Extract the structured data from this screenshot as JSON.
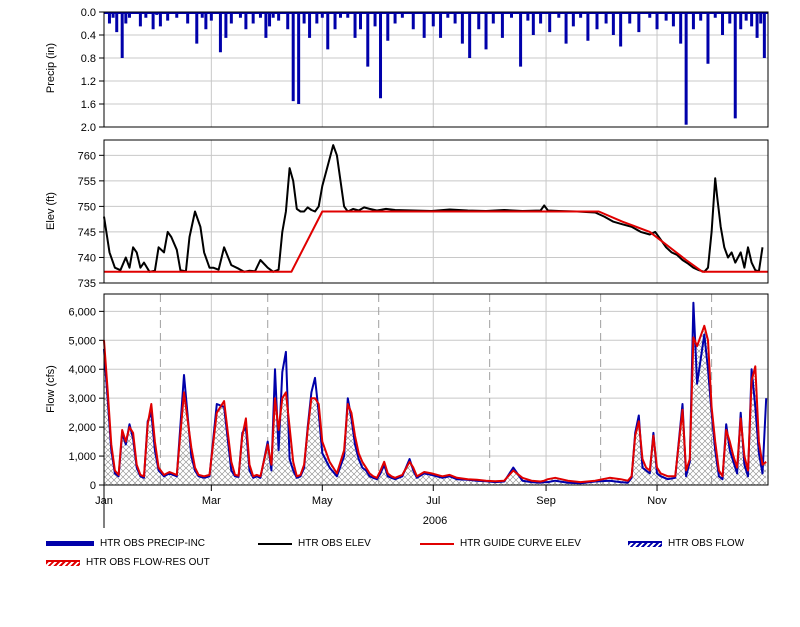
{
  "chart_data": [
    {
      "type": "bar",
      "ylabel": "Precip (in)",
      "ylim": [
        2.0,
        0.0
      ],
      "inverted": true,
      "yticks": [
        "0.0",
        "0.4",
        "0.8",
        "1.2",
        "1.6",
        "2.0"
      ],
      "grid": true,
      "color": "#0000aa",
      "series": [
        {
          "name": "HTR OBS PRECIP-INC",
          "x_day": [
            3,
            5,
            7,
            10,
            12,
            14,
            20,
            23,
            27,
            29,
            31,
            35,
            40,
            46,
            51,
            54,
            56,
            59,
            64,
            67,
            70,
            75,
            78,
            82,
            86,
            89,
            91,
            93,
            96,
            101,
            104,
            107,
            110,
            113,
            117,
            120,
            123,
            127,
            130,
            134,
            138,
            141,
            145,
            149,
            152,
            156,
            160,
            164,
            170,
            176,
            181,
            185,
            189,
            193,
            197,
            201,
            206,
            210,
            214,
            219,
            224,
            229,
            233,
            236,
            240,
            245,
            250,
            254,
            258,
            262,
            266,
            271,
            276,
            280,
            284,
            289,
            294,
            300,
            304,
            309,
            313,
            317,
            320,
            324,
            328,
            332,
            336,
            340,
            344,
            347,
            350,
            353,
            356,
            359,
            361,
            363
          ],
          "values": [
            0.2,
            0.1,
            0.35,
            0.8,
            0.2,
            0.1,
            0.25,
            0.1,
            0.3,
            0.05,
            0.25,
            0.15,
            0.1,
            0.2,
            0.55,
            0.1,
            0.3,
            0.15,
            0.7,
            0.45,
            0.2,
            0.1,
            0.3,
            0.2,
            0.1,
            0.45,
            0.25,
            0.1,
            0.15,
            0.3,
            1.55,
            1.6,
            0.2,
            0.45,
            0.2,
            0.1,
            0.65,
            0.3,
            0.1,
            0.1,
            0.45,
            0.3,
            0.95,
            0.25,
            1.5,
            0.5,
            0.2,
            0.1,
            0.3,
            0.45,
            0.25,
            0.45,
            0.1,
            0.2,
            0.55,
            0.8,
            0.3,
            0.65,
            0.2,
            0.45,
            0.1,
            0.95,
            0.15,
            0.4,
            0.2,
            0.35,
            0.1,
            0.55,
            0.25,
            0.1,
            0.5,
            0.3,
            0.2,
            0.4,
            0.6,
            0.2,
            0.35,
            0.1,
            0.3,
            0.15,
            0.25,
            0.55,
            1.96,
            0.3,
            0.15,
            0.9,
            0.1,
            0.4,
            0.2,
            1.85,
            0.3,
            0.15,
            0.25,
            0.45,
            0.2,
            0.8,
            0.4
          ]
        }
      ]
    },
    {
      "type": "line",
      "ylabel": "Elev (ft)",
      "ylim": [
        735,
        763
      ],
      "yticks": [
        "735",
        "740",
        "745",
        "750",
        "755",
        "760"
      ],
      "grid": true,
      "series": [
        {
          "name": "HTR OBS ELEV",
          "color": "#000000",
          "x_day": [
            0,
            3,
            6,
            9,
            12,
            14,
            16,
            18,
            20,
            22,
            25,
            28,
            30,
            33,
            35,
            37,
            40,
            42,
            45,
            47,
            50,
            53,
            55,
            58,
            60,
            63,
            66,
            70,
            74,
            77,
            80,
            83,
            86,
            90,
            93,
            96,
            98,
            100,
            102,
            104,
            106,
            108,
            110,
            112,
            114,
            116,
            118,
            120,
            123,
            126,
            128,
            130,
            132,
            134,
            137,
            140,
            143,
            146,
            150,
            155,
            160,
            170,
            180,
            190,
            200,
            210,
            220,
            230,
            240,
            242,
            244,
            250,
            260,
            270,
            275,
            280,
            285,
            290,
            295,
            300,
            303,
            306,
            309,
            312,
            315,
            318,
            321,
            324,
            327,
            330,
            332,
            334,
            336,
            337,
            339,
            341,
            343,
            345,
            347,
            350,
            352,
            354,
            356,
            358,
            360,
            362,
            364
          ],
          "values": [
            748,
            741,
            738,
            737.5,
            740,
            738,
            742,
            741,
            738,
            739,
            737.2,
            737.4,
            742,
            741,
            745,
            744,
            741.5,
            737.5,
            737.3,
            744,
            749,
            746,
            741,
            738,
            738,
            737.6,
            742,
            738.5,
            737.8,
            737.2,
            737.4,
            737.3,
            739.5,
            738,
            737.2,
            737.6,
            745,
            749,
            757.5,
            755,
            749.5,
            749,
            749,
            749.8,
            749.3,
            749,
            750,
            754,
            758,
            762,
            760,
            755,
            750,
            749,
            749.5,
            749.2,
            749.8,
            749.5,
            749.2,
            749.5,
            749.3,
            749.2,
            749.1,
            749.4,
            749.2,
            749.1,
            749.3,
            749.1,
            749.2,
            750.2,
            749.2,
            749.1,
            749,
            748.8,
            748,
            747,
            746.5,
            746,
            745,
            744.5,
            745,
            743.5,
            742,
            741,
            740.5,
            739.5,
            738.8,
            738,
            737.5,
            737.2,
            738,
            745,
            755.5,
            752,
            746,
            742,
            740,
            741,
            739,
            741,
            738,
            742,
            739,
            737.5,
            737.3,
            742
          ]
        },
        {
          "name": "HTR GUIDE CURVE ELEV",
          "color": "#e00000",
          "x_day": [
            0,
            103,
            120,
            262,
            272,
            285,
            300,
            320,
            329,
            365
          ],
          "values": [
            737.2,
            737.2,
            749,
            749,
            749,
            747,
            745,
            739.5,
            737.2,
            737.2
          ]
        }
      ]
    },
    {
      "type": "area",
      "xlabel": "2006",
      "ylabel": "Flow (cfs)",
      "ylim": [
        0,
        6600
      ],
      "yticks": [
        "0",
        "1,000",
        "2,000",
        "3,000",
        "4,000",
        "5,000",
        "6,000"
      ],
      "xticks": [
        "Jan",
        "Mar",
        "May",
        "Jul",
        "Sep",
        "Nov"
      ],
      "xtick_day": [
        0,
        59,
        120,
        181,
        243,
        304
      ],
      "event_lines_day": [
        31,
        90,
        151,
        212,
        273,
        334
      ],
      "grid": true,
      "series": [
        {
          "name": "HTR OBS FLOW",
          "color": "#0000aa",
          "x_day": [
            0,
            2,
            4,
            6,
            8,
            10,
            12,
            14,
            16,
            18,
            20,
            22,
            24,
            26,
            28,
            30,
            33,
            36,
            40,
            44,
            48,
            50,
            52,
            55,
            58,
            62,
            66,
            70,
            72,
            74,
            76,
            78,
            80,
            82,
            84,
            86,
            90,
            92,
            94,
            96,
            98,
            100,
            102,
            104,
            106,
            108,
            110,
            112,
            114,
            116,
            118,
            120,
            124,
            128,
            132,
            134,
            136,
            138,
            140,
            142,
            144,
            146,
            148,
            150,
            152,
            154,
            156,
            158,
            160,
            164,
            168,
            170,
            172,
            176,
            180,
            186,
            190,
            194,
            200,
            205,
            210,
            215,
            220,
            225,
            230,
            235,
            240,
            242,
            244,
            248,
            255,
            262,
            270,
            278,
            284,
            288,
            290,
            292,
            294,
            296,
            298,
            300,
            302,
            304,
            306,
            310,
            314,
            318,
            320,
            322,
            324,
            326,
            330,
            332,
            334,
            336,
            338,
            340,
            342,
            344,
            346,
            348,
            350,
            352,
            354,
            356,
            358,
            360,
            362,
            364
          ],
          "values": [
            4700,
            3000,
            1200,
            400,
            300,
            1800,
            1400,
            2100,
            1600,
            600,
            300,
            250,
            2200,
            2500,
            1200,
            500,
            300,
            400,
            300,
            3800,
            1000,
            500,
            300,
            250,
            300,
            2800,
            2700,
            500,
            300,
            280,
            1800,
            2000,
            500,
            250,
            300,
            250,
            1500,
            500,
            4000,
            1200,
            3900,
            4600,
            900,
            500,
            250,
            300,
            600,
            2000,
            3200,
            3700,
            2500,
            1100,
            600,
            300,
            1000,
            3000,
            2300,
            1400,
            900,
            600,
            500,
            300,
            250,
            200,
            400,
            700,
            300,
            250,
            200,
            300,
            900,
            500,
            250,
            400,
            350,
            250,
            300,
            200,
            180,
            150,
            130,
            100,
            120,
            600,
            150,
            100,
            80,
            100,
            100,
            150,
            80,
            60,
            120,
            150,
            100,
            80,
            250,
            1800,
            2400,
            600,
            500,
            400,
            1800,
            400,
            300,
            200,
            250,
            2800,
            300,
            800,
            6300,
            3500,
            5200,
            4000,
            2500,
            1200,
            300,
            200,
            2100,
            1200,
            800,
            400,
            2500,
            700,
            300,
            4000,
            2700,
            1100,
            400,
            3000
          ]
        },
        {
          "name": "HTR OBS FLOW-RES OUT",
          "color": "#e00000",
          "x_day": [
            0,
            2,
            4,
            6,
            8,
            10,
            12,
            14,
            16,
            18,
            20,
            22,
            24,
            26,
            28,
            30,
            33,
            36,
            40,
            44,
            48,
            50,
            52,
            55,
            58,
            62,
            66,
            70,
            72,
            74,
            76,
            78,
            80,
            82,
            84,
            86,
            90,
            92,
            94,
            96,
            98,
            100,
            102,
            104,
            106,
            108,
            110,
            112,
            114,
            116,
            118,
            120,
            124,
            128,
            132,
            134,
            136,
            138,
            140,
            142,
            144,
            146,
            148,
            150,
            152,
            154,
            156,
            158,
            160,
            164,
            168,
            170,
            172,
            176,
            180,
            186,
            190,
            194,
            200,
            205,
            210,
            215,
            220,
            225,
            230,
            235,
            240,
            242,
            244,
            248,
            255,
            262,
            270,
            278,
            284,
            288,
            290,
            292,
            294,
            296,
            298,
            300,
            302,
            304,
            306,
            310,
            314,
            318,
            320,
            322,
            324,
            326,
            330,
            332,
            334,
            336,
            338,
            340,
            342,
            344,
            346,
            348,
            350,
            352,
            354,
            356,
            358,
            360,
            362,
            364
          ],
          "values": [
            5000,
            3300,
            1400,
            500,
            350,
            1900,
            1500,
            2000,
            1800,
            700,
            350,
            300,
            2100,
            2800,
            1500,
            600,
            350,
            450,
            350,
            3200,
            1300,
            600,
            350,
            300,
            350,
            2500,
            2900,
            800,
            350,
            320,
            1700,
            2300,
            700,
            300,
            350,
            300,
            1400,
            700,
            3000,
            1900,
            3000,
            3200,
            2000,
            800,
            300,
            350,
            700,
            1900,
            3000,
            3000,
            2800,
            1500,
            800,
            400,
            1200,
            2800,
            2500,
            1700,
            1100,
            800,
            600,
            400,
            300,
            250,
            500,
            800,
            400,
            300,
            250,
            350,
            800,
            600,
            300,
            450,
            400,
            300,
            350,
            250,
            200,
            180,
            150,
            130,
            150,
            500,
            250,
            150,
            120,
            150,
            200,
            250,
            150,
            100,
            150,
            250,
            200,
            150,
            300,
            1700,
            2200,
            900,
            600,
            500,
            1700,
            600,
            400,
            300,
            300,
            2600,
            500,
            900,
            5100,
            4800,
            5500,
            5000,
            2700,
            1500,
            500,
            300,
            1900,
            1500,
            1000,
            600,
            2300,
            1000,
            500,
            3600,
            4100,
            1500,
            700,
            800
          ]
        }
      ]
    }
  ],
  "legend": {
    "items": [
      {
        "label": "HTR OBS PRECIP-INC"
      },
      {
        "label": "HTR OBS ELEV"
      },
      {
        "label": "HTR GUIDE CURVE ELEV"
      },
      {
        "label": "HTR OBS FLOW"
      },
      {
        "label": "HTR OBS FLOW-RES OUT"
      }
    ]
  }
}
